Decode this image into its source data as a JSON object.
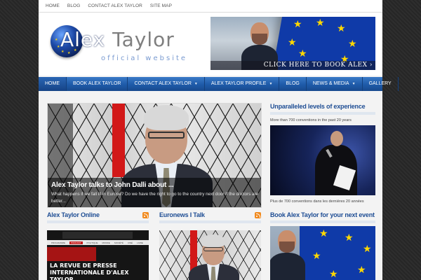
{
  "toplinks": [
    "HOME",
    "BLOG",
    "CONTACT ALEX TAYLOR",
    "SITE MAP"
  ],
  "logo": {
    "first": "Alex",
    "last": "Taylor",
    "subtitle": "official website"
  },
  "banner": {
    "cta": "CLICK HERE TO BOOK ALEX ›"
  },
  "nav": [
    {
      "label": "HOME",
      "active": true,
      "dropdown": false
    },
    {
      "label": "BOOK ALEX TAYLOR",
      "active": false,
      "dropdown": false
    },
    {
      "label": "CONTACT ALEX TAYLOR",
      "active": false,
      "dropdown": true
    },
    {
      "label": "ALEX TAYLOR PROFILE",
      "active": false,
      "dropdown": true
    },
    {
      "label": "BLOG",
      "active": false,
      "dropdown": false
    },
    {
      "label": "NEWS & MEDIA",
      "active": false,
      "dropdown": true
    },
    {
      "label": "GALLERY",
      "active": false,
      "dropdown": false
    }
  ],
  "feature": {
    "title": "Alex Taylor talks to John Dalli about ...",
    "description": "What happens if we fall ill in Europe? Do we have the right to go to the country next door if the doctors are better..."
  },
  "sidebar": {
    "experience_title": "Unparalleled levels of experience",
    "experience_text_en": "More than 700 conventions in the past 20 years",
    "experience_text_fr": "Plus de 700 conventions dans les dernières 20 années",
    "book_title": "Book Alex Taylor for your next event"
  },
  "widgets": {
    "left_title": "Alex Taylor Online",
    "left_thumb_title_line1": "LA REVUE DE PRESSE",
    "left_thumb_title_line2": "INTERNATIONALE D'ALEX TAYLOR",
    "left_thumb_menu": [
      "PROGRAMME",
      "PODCAST",
      "POLITIQUE",
      "MONDE",
      "SOCIÉTÉ",
      "CINÉ",
      "LIVRE"
    ],
    "right_title": "Euronews I Talk"
  },
  "colors": {
    "accent": "#1e5aa8",
    "title": "#1f4e94",
    "rss": "#f18a1e"
  }
}
